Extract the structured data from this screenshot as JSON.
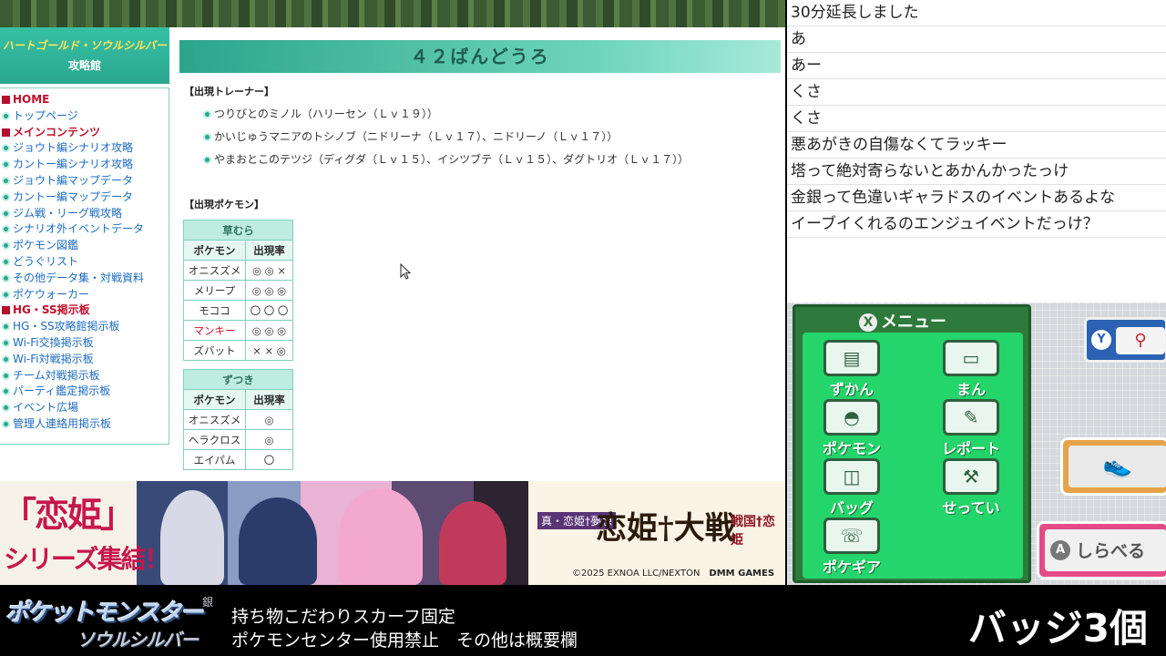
{
  "site": {
    "logo_line1": "ハートゴールド・ソウルシルバー",
    "logo_line2": "攻略館"
  },
  "nav": [
    {
      "type": "head",
      "label": "HOME"
    },
    {
      "type": "item",
      "label": "トップページ"
    },
    {
      "type": "head",
      "label": "メインコンテンツ"
    },
    {
      "type": "item",
      "label": "ジョウト編シナリオ攻略"
    },
    {
      "type": "item",
      "label": "カントー編シナリオ攻略"
    },
    {
      "type": "item",
      "label": "ジョウト編マップデータ"
    },
    {
      "type": "item",
      "label": "カントー編マップデータ"
    },
    {
      "type": "item",
      "label": "ジム戦・リーグ戦攻略"
    },
    {
      "type": "item",
      "label": "シナリオ外イベントデータ"
    },
    {
      "type": "item",
      "label": "ポケモン図鑑"
    },
    {
      "type": "item",
      "label": "どうぐリスト"
    },
    {
      "type": "item",
      "label": "その他データ集・対戦資料"
    },
    {
      "type": "item",
      "label": "ポケウォーカー"
    },
    {
      "type": "head",
      "label": "HG・SS掲示板"
    },
    {
      "type": "item",
      "label": "HG・SS攻略館掲示板"
    },
    {
      "type": "item",
      "label": "Wi-Fi交換掲示板"
    },
    {
      "type": "item",
      "label": "Wi-Fi対戦掲示板"
    },
    {
      "type": "item",
      "label": "チーム対戦掲示板"
    },
    {
      "type": "item",
      "label": "パーティ鑑定掲示板"
    },
    {
      "type": "item",
      "label": "イベント広場"
    },
    {
      "type": "item",
      "label": "管理人連絡用掲示板"
    }
  ],
  "content": {
    "title": "４２ばんどうろ",
    "trainers_head": "【出現トレーナー】",
    "trainers": [
      "つりびとのミノル（ハリーセン（Ｌｖ１９））",
      "かいじゅうマニアのトシノブ（ニドリーナ（Ｌｖ１７）、ニドリーノ（Ｌｖ１７））",
      "やまおとこのテツジ（ディグダ（Ｌｖ１５）、イシツブテ（Ｌｖ１５）、ダグトリオ（Ｌｖ１７））"
    ],
    "pokemon_head": "【出現ポケモン】",
    "grass": {
      "caption": "草むら",
      "col_pokemon": "ポケモン",
      "col_rate": "出現率",
      "rows": [
        {
          "name": "オニスズメ",
          "rate": "◎ ◎ ×",
          "red": false
        },
        {
          "name": "メリープ",
          "rate": "◎ ◎ ◎",
          "red": false
        },
        {
          "name": "モココ",
          "rate": "〇 〇 〇",
          "red": false
        },
        {
          "name": "マンキー",
          "rate": "◎ ◎ ◎",
          "red": true
        },
        {
          "name": "ズバット",
          "rate": "× × ◎",
          "red": false
        }
      ]
    },
    "headbutt": {
      "caption": "ずつき",
      "col_pokemon": "ポケモン",
      "col_rate": "出現率",
      "rows": [
        {
          "name": "オニスズメ",
          "rate": "◎"
        },
        {
          "name": "ヘラクロス",
          "rate": "◎"
        },
        {
          "name": "エイパム",
          "rate": "〇"
        }
      ]
    }
  },
  "scroll_tab": "⌄",
  "ad": {
    "tagline_big": "「恋姫」",
    "tagline_sub": "シリーズ集結！",
    "logo_series": "真・恋姫†夢想",
    "logo_main": "恋姫†大戦",
    "logo_right": "戦国†恋姫",
    "copyright": "©2025 EXNOA LLC/NEXTON",
    "brand": "DMM GAMES"
  },
  "chat": [
    "30分延長しました",
    "あ",
    "あー",
    "くさ",
    "くさ",
    "悪あがきの自傷なくてラッキー",
    "塔って絶対寄らないとあかんかったっけ",
    "金銀って色違いギャラドスのイベントあるよな",
    "イーブイくれるのエンジュイベントだっけ？"
  ],
  "ds": {
    "menu_title": "メニュー",
    "items": {
      "pokedex": "ずかん",
      "trainer_card": "まん",
      "pokemon": "ポケモン",
      "report": "レポート",
      "bag": "バッグ",
      "settings": "せってい",
      "pokegear": "ポケギア"
    },
    "registered_button": "Y",
    "check_label": "しらべる",
    "check_button": "A"
  },
  "overlay": {
    "game_logo_main": "ポケットモンスター",
    "game_logo_edition": "ソウルシルバー",
    "game_logo_gin": "銀",
    "rule_line1": "持ち物こだわりスカーフ固定",
    "rule_line2": "ポケモンセンター使用禁止　その他は概要欄",
    "badge_count": "バッジ3個"
  }
}
